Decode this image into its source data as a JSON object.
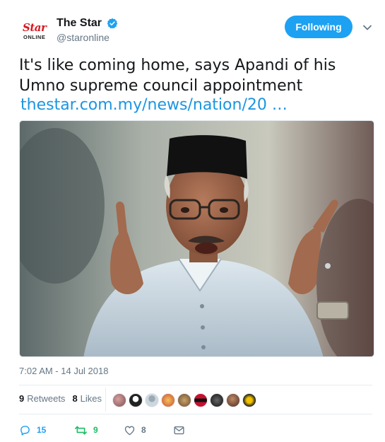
{
  "account": {
    "avatar_logo_main": "Star",
    "avatar_logo_sub": "ONLINE",
    "display_name": "The Star",
    "handle": "@staronline",
    "verified": true
  },
  "follow_button": {
    "label": "Following"
  },
  "tweet": {
    "text_line1": "It's like coming home, says Apandi of his",
    "text_line2": "Umno supreme council appointment",
    "link": "thestar.com.my/news/nation/20 …",
    "photo_icon": "man-in-songkok-photo",
    "timestamp": "7:02 AM - 14 Jul 2018"
  },
  "stats": {
    "retweets_count": "9",
    "retweets_label": "Retweets",
    "likes_count": "8",
    "likes_label": "Likes"
  },
  "actions": {
    "reply_count": "15",
    "retweet_count": "9",
    "like_count": "8"
  },
  "colors": {
    "accent": "#1da1f2",
    "link": "#1b95e0",
    "retweet": "#17bf63",
    "muted": "#657786"
  }
}
